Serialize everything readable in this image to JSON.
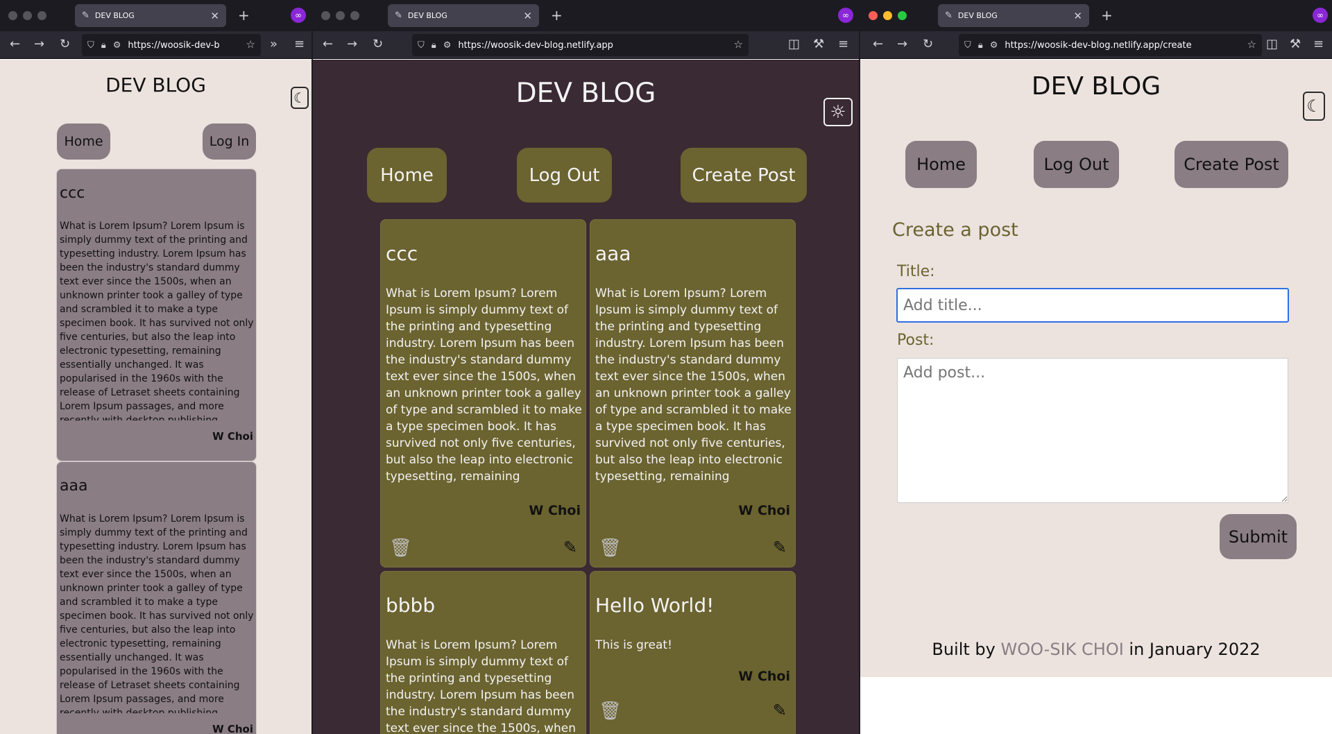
{
  "colors": {
    "browser_chrome": "#2b2a33",
    "light_bg": "#ece3df",
    "dark_bg": "#3a2a33",
    "light_card": "#8a7d84",
    "dark_card": "#6b6330",
    "accent_olive": "#6b6330",
    "link": "#8a7d84"
  },
  "windows": [
    {
      "tab_title": "DEV BLOG",
      "url": "https://woosik-dev-b",
      "site_title": "DEV BLOG",
      "theme_icon": "moon-icon",
      "theme_glyph": "☾",
      "nav": {
        "home": "Home",
        "login": "Log In"
      },
      "posts": [
        {
          "title": "ccc",
          "body": "What is Lorem Ipsum? Lorem Ipsum is simply dummy text of the printing and typesetting industry. Lorem Ipsum has been the industry's standard dummy text ever since the 1500s, when an unknown printer took a galley of type and scrambled it to make a type specimen book. It has survived not only five centuries, but also the leap into electronic typesetting, remaining essentially unchanged. It was popularised in the 1960s with the release of Letraset sheets containing Lorem Ipsum passages, and more recently with desktop publishing software like Aldus PageMaker including",
          "author": "W Choi"
        },
        {
          "title": "aaa",
          "body": "What is Lorem Ipsum? Lorem Ipsum is simply dummy text of the printing and typesetting industry. Lorem Ipsum has been the industry's standard dummy text ever since the 1500s, when an unknown printer took a galley of type and scrambled it to make a type specimen book. It has survived not only five centuries, but also the leap into electronic typesetting, remaining essentially unchanged. It was popularised in the 1960s with the release of Letraset sheets containing Lorem Ipsum passages, and more recently with desktop publishing software like Aldus PageMaker including",
          "author": "W Choi"
        }
      ]
    },
    {
      "tab_title": "DEV BLOG",
      "url": "https://woosik-dev-blog.netlify.app",
      "site_title": "DEV BLOG",
      "theme_icon": "sun-icon",
      "theme_glyph": "☼",
      "nav": {
        "home": "Home",
        "logout": "Log Out",
        "create": "Create Post"
      },
      "posts": [
        {
          "title": "ccc",
          "body": "What is Lorem Ipsum? Lorem Ipsum is simply dummy text of the printing and typesetting industry. Lorem Ipsum has been the industry's standard dummy text ever since the 1500s, when an unknown printer took a galley of type and scrambled it to make a type specimen book. It has survived not only five centuries, but also the leap into electronic typesetting, remaining essentially",
          "author": "W Choi"
        },
        {
          "title": "aaa",
          "body": "What is Lorem Ipsum? Lorem Ipsum is simply dummy text of the printing and typesetting industry. Lorem Ipsum has been the industry's standard dummy text ever since the 1500s, when an unknown printer took a galley of type and scrambled it to make a type specimen book. It has survived not only five centuries, but also the leap into electronic typesetting, remaining essentially",
          "author": "W Choi"
        },
        {
          "title": "bbbb",
          "body": "What is Lorem Ipsum? Lorem Ipsum is simply dummy text of the printing and typesetting industry. Lorem Ipsum has been the industry's standard dummy text ever since the 1500s, when",
          "author": ""
        },
        {
          "title": "Hello World!",
          "body": "This is great!",
          "author": "W Choi"
        }
      ]
    },
    {
      "tab_title": "DEV BLOG",
      "url": "https://woosik-dev-blog.netlify.app/create",
      "site_title": "DEV BLOG",
      "theme_icon": "moon-icon",
      "theme_glyph": "☾",
      "nav": {
        "home": "Home",
        "logout": "Log Out",
        "create": "Create Post"
      },
      "form": {
        "heading": "Create a post",
        "title_label": "Title:",
        "title_placeholder": "Add title...",
        "post_label": "Post:",
        "post_placeholder": "Add post...",
        "submit": "Submit"
      },
      "footer": {
        "prefix": "Built by ",
        "author": "WOO-SIK CHOI",
        "suffix": " in January 2022"
      }
    }
  ]
}
